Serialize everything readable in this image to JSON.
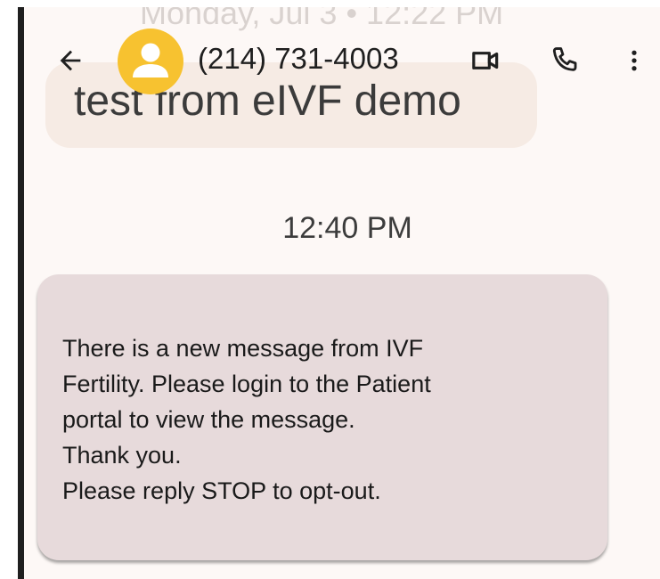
{
  "background_thread": {
    "date_header": "Monday, Jul 3 • 12:22 PM",
    "previous_message": "test from eIVF demo"
  },
  "app_bar": {
    "back_icon": "arrow-back-icon",
    "avatar_icon": "person-icon",
    "contact_name": "(214) 731-4003",
    "video_icon": "videocam-icon",
    "call_icon": "phone-icon",
    "more_icon": "more-vert-icon"
  },
  "thread": {
    "timestamp": "12:40 PM",
    "message": {
      "lines": [
        "There is a new message from IVF",
        "Fertility. Please login to the Patient",
        "portal to view the message.",
        "Thank you.",
        "Please reply STOP to opt-out."
      ]
    }
  },
  "colors": {
    "screen_background": "#fdf8f6",
    "avatar": "#f7c230",
    "incoming_bubble": "#e7dadb",
    "ghost_bubble": "#f6ebe4"
  }
}
